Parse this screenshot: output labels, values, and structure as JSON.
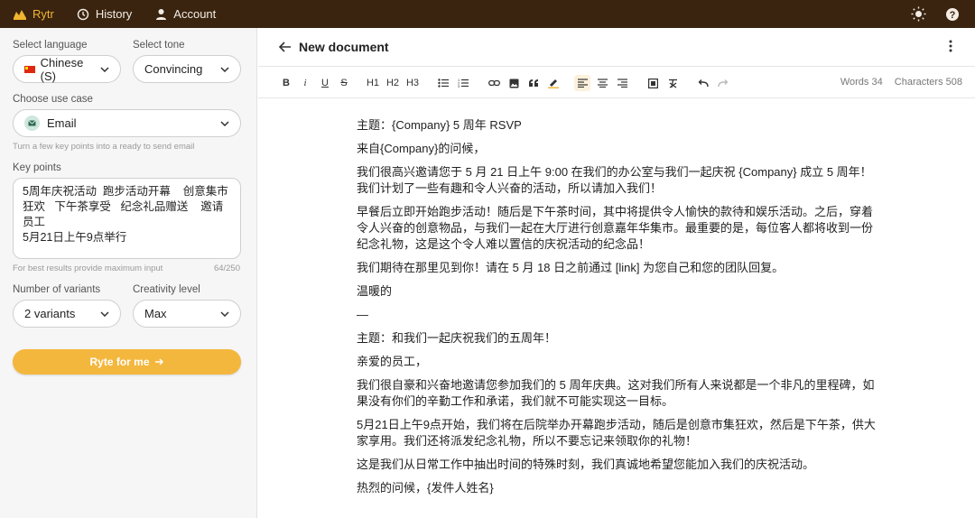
{
  "topbar": {
    "brand": "Rytr",
    "history": "History",
    "account": "Account"
  },
  "sidebar": {
    "language_label": "Select language",
    "language_value": "Chinese (S)",
    "tone_label": "Select tone",
    "tone_value": "Convincing",
    "use_case_label": "Choose use case",
    "use_case_value": "Email",
    "use_case_hint": "Turn a few key points into a ready to send email",
    "key_points_label": "Key points",
    "key_points_value": "5周年庆祝活动  跑步活动开幕    创意集市狂欢   下午茶享受   纪念礼品赠送    邀请员工\n5月21日上午9点举行",
    "key_points_hint": "For best results provide maximum input",
    "key_points_counter": "64/250",
    "variants_label": "Number of variants",
    "variants_value": "2 variants",
    "creativity_label": "Creativity level",
    "creativity_value": "Max",
    "ryte_button": "Ryte for me"
  },
  "document": {
    "title": "New document",
    "words": "Words 34",
    "characters": "Characters 508",
    "toolbar": {
      "bold": "B",
      "italic": "i",
      "underline": "U",
      "strike": "S",
      "h1": "H1",
      "h2": "H2",
      "h3": "H3"
    },
    "paragraphs": [
      "主题：{Company} 5 周年 RSVP",
      "来自{Company}的问候，",
      "我们很高兴邀请您于 5 月 21 日上午 9:00 在我们的办公室与我们一起庆祝 {Company} 成立 5 周年！我们计划了一些有趣和令人兴奋的活动，所以请加入我们！",
      "早餐后立即开始跑步活动！随后是下午茶时间，其中将提供令人愉快的款待和娱乐活动。之后，穿着令人兴奋的创意物品，与我们一起在大厅进行创意嘉年华集市。最重要的是，每位客人都将收到一份纪念礼物，这是这个令人难以置信的庆祝活动的纪念品！",
      "我们期待在那里见到你！请在 5 月 18 日之前通过 [link] 为您自己和您的团队回复。",
      "温暖的",
      "—",
      "主题：和我们一起庆祝我们的五周年！",
      "亲爱的员工，",
      "我们很自豪和兴奋地邀请您参加我们的 5 周年庆典。这对我们所有人来说都是一个非凡的里程碑，如果没有你们的辛勤工作和承诺，我们就不可能实现这一目标。",
      "5月21日上午9点开始，我们将在后院举办开幕跑步活动，随后是创意市集狂欢，然后是下午茶，供大家享用。我们还将派发纪念礼物，所以不要忘记来领取你的礼物！",
      "这是我们从日常工作中抽出时间的特殊时刻，我们真诚地希望您能加入我们的庆祝活动。",
      "热烈的问候，{发件人姓名}"
    ]
  }
}
